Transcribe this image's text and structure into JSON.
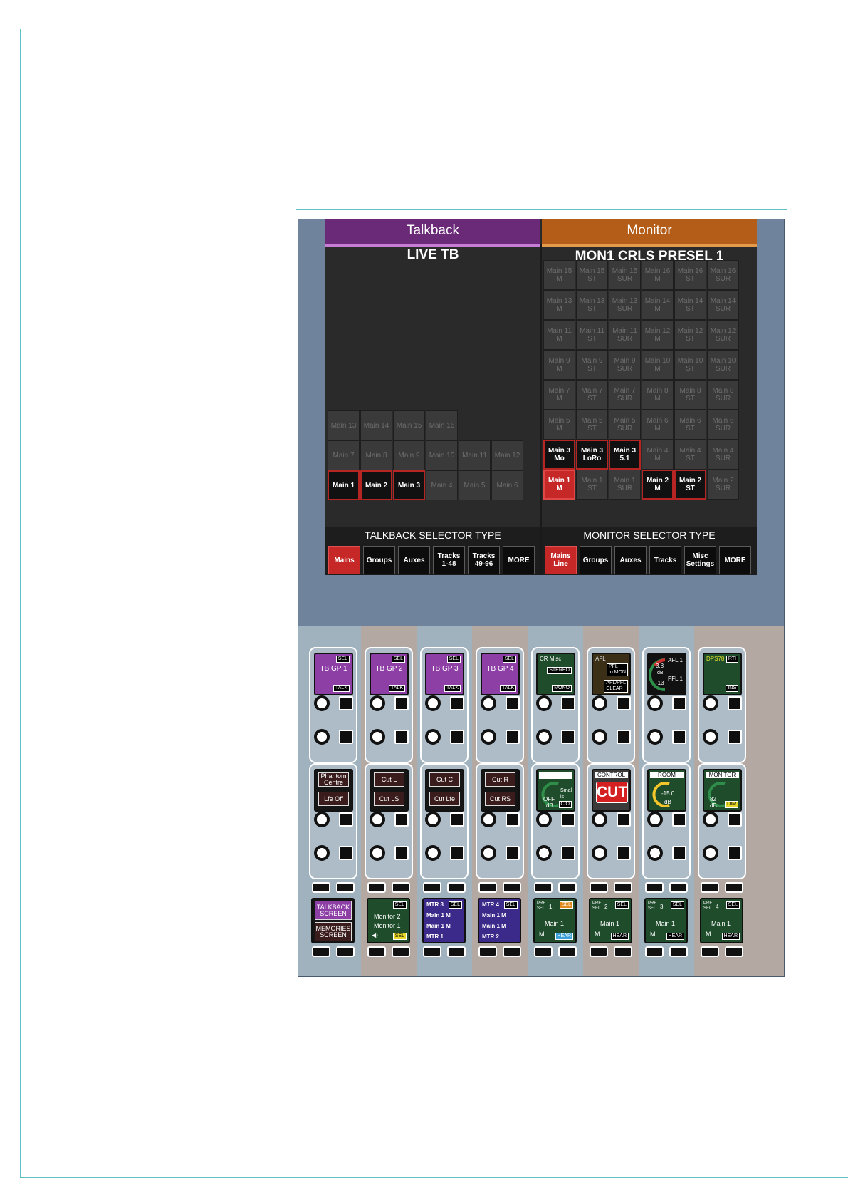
{
  "talkback": {
    "header": "Talkback",
    "subtitle": "LIVE TB",
    "grid": [
      {
        "label": "Main 13",
        "state": "dim"
      },
      {
        "label": "Main 14",
        "state": "dim"
      },
      {
        "label": "Main 15",
        "state": "dim"
      },
      {
        "label": "Main 16",
        "state": "dim"
      },
      {
        "label": "Main 7",
        "state": "dim"
      },
      {
        "label": "Main 8",
        "state": "dim"
      },
      {
        "label": "Main 9",
        "state": "dim"
      },
      {
        "label": "Main 10",
        "state": "dim"
      },
      {
        "label": "Main 11",
        "state": "dim"
      },
      {
        "label": "Main 12",
        "state": "dim"
      },
      {
        "label": "Main 1",
        "state": "active"
      },
      {
        "label": "Main 2",
        "state": "active"
      },
      {
        "label": "Main 3",
        "state": "active"
      },
      {
        "label": "Main 4",
        "state": "dim"
      },
      {
        "label": "Main 5",
        "state": "dim"
      },
      {
        "label": "Main 6",
        "state": "dim"
      }
    ],
    "selector_title": "TALKBACK SELECTOR TYPE",
    "selector_buttons": [
      {
        "label": "Mains",
        "state": "red"
      },
      {
        "label": "Groups",
        "state": "normal"
      },
      {
        "label": "Auxes",
        "state": "normal"
      },
      {
        "label": "Tracks\n1-48",
        "state": "normal"
      },
      {
        "label": "Tracks\n49-96",
        "state": "normal"
      },
      {
        "label": "MORE",
        "state": "normal"
      }
    ]
  },
  "monitor": {
    "header": "Monitor",
    "subtitle": "MON1 CRLS  PRESEL 1",
    "grid": [
      {
        "label": "Main 15\nM",
        "state": "dim"
      },
      {
        "label": "Main 15\nST",
        "state": "dim"
      },
      {
        "label": "Main 15\nSUR",
        "state": "dim"
      },
      {
        "label": "Main 16\nM",
        "state": "dim"
      },
      {
        "label": "Main 16\nST",
        "state": "dim"
      },
      {
        "label": "Main 16\nSUR",
        "state": "dim"
      },
      {
        "label": "Main 13\nM",
        "state": "dim"
      },
      {
        "label": "Main 13\nST",
        "state": "dim"
      },
      {
        "label": "Main 13\nSUR",
        "state": "dim"
      },
      {
        "label": "Main 14\nM",
        "state": "dim"
      },
      {
        "label": "Main 14\nST",
        "state": "dim"
      },
      {
        "label": "Main 14\nSUR",
        "state": "dim"
      },
      {
        "label": "Main 11\nM",
        "state": "dim"
      },
      {
        "label": "Main 11\nST",
        "state": "dim"
      },
      {
        "label": "Main 11\nSUR",
        "state": "dim"
      },
      {
        "label": "Main 12\nM",
        "state": "dim"
      },
      {
        "label": "Main 12\nST",
        "state": "dim"
      },
      {
        "label": "Main 12\nSUR",
        "state": "dim"
      },
      {
        "label": "Main 9\nM",
        "state": "dim"
      },
      {
        "label": "Main 9\nST",
        "state": "dim"
      },
      {
        "label": "Main 9\nSUR",
        "state": "dim"
      },
      {
        "label": "Main 10\nM",
        "state": "dim"
      },
      {
        "label": "Main 10\nST",
        "state": "dim"
      },
      {
        "label": "Main 10\nSUR",
        "state": "dim"
      },
      {
        "label": "Main 7\nM",
        "state": "dim"
      },
      {
        "label": "Main 7\nST",
        "state": "dim"
      },
      {
        "label": "Main 7\nSUR",
        "state": "dim"
      },
      {
        "label": "Main 8\nM",
        "state": "dim"
      },
      {
        "label": "Main 8\nST",
        "state": "dim"
      },
      {
        "label": "Main 8\nSUR",
        "state": "dim"
      },
      {
        "label": "Main 5\nM",
        "state": "dim"
      },
      {
        "label": "Main 5\nST",
        "state": "dim"
      },
      {
        "label": "Main 5\nSUR",
        "state": "dim"
      },
      {
        "label": "Main 6\nM",
        "state": "dim"
      },
      {
        "label": "Main 6\nST",
        "state": "dim"
      },
      {
        "label": "Main 6\nSUR",
        "state": "dim"
      },
      {
        "label": "Main 3\nMo",
        "state": "active"
      },
      {
        "label": "Main 3\nLoRo",
        "state": "active"
      },
      {
        "label": "Main 3\n5.1",
        "state": "active"
      },
      {
        "label": "Main 4\nM",
        "state": "dim"
      },
      {
        "label": "Main 4\nST",
        "state": "dim"
      },
      {
        "label": "Main 4\nSUR",
        "state": "dim"
      },
      {
        "label": "Main 1\nM",
        "state": "red"
      },
      {
        "label": "Main 1\nST",
        "state": "dim"
      },
      {
        "label": "Main 1\nSUR",
        "state": "dim"
      },
      {
        "label": "Main 2\nM",
        "state": "active"
      },
      {
        "label": "Main 2\nST",
        "state": "active"
      },
      {
        "label": "Main 2\nSUR",
        "state": "dim"
      }
    ],
    "selector_title": "MONITOR SELECTOR TYPE",
    "selector_buttons": [
      {
        "label": "Mains\nLine",
        "state": "red"
      },
      {
        "label": "Groups",
        "state": "normal"
      },
      {
        "label": "Auxes",
        "state": "normal"
      },
      {
        "label": "Tracks",
        "state": "normal"
      },
      {
        "label": "Misc\nSettings",
        "state": "normal"
      },
      {
        "label": "MORE",
        "state": "normal"
      }
    ]
  },
  "strip": {
    "column_colors": [
      "#9fb2bd",
      "#b3a8a2",
      "#9fb2bd",
      "#b3a8a2",
      "#9fb2bd",
      "#b3a8a2",
      "#9fb2bd",
      "#b3a8a2"
    ],
    "top_displays": [
      {
        "type": "tb",
        "title": "TB GP 1",
        "sel": "SEL",
        "talk": "TALK"
      },
      {
        "type": "tb",
        "title": "TB GP 2",
        "sel": "SEL",
        "talk": "TALK"
      },
      {
        "type": "tb",
        "title": "TB GP 3",
        "sel": "SEL",
        "talk": "TALK"
      },
      {
        "type": "tb",
        "title": "TB GP 4",
        "sel": "SEL",
        "talk": "TALK"
      },
      {
        "type": "crmisc",
        "title": "CR Misc",
        "btn1": "STEREO",
        "btn2": "MONO"
      },
      {
        "type": "afl",
        "title": "AFL",
        "btn1": "PFL\nto MON",
        "btn2": "AFL/PFL\nCLEAR"
      },
      {
        "type": "aflpfl",
        "afl": "AFL 1",
        "pfl": "PFL 1",
        "v1": "3.8",
        "v2": "-13",
        "unit": "dB"
      },
      {
        "type": "dps",
        "title": "DPS78",
        "btn1": "RTI",
        "btn2": "INS"
      }
    ],
    "mid_displays": [
      {
        "type": "two",
        "b1": "Phantom\nCentre",
        "b2": "Lfe Off"
      },
      {
        "type": "two",
        "b1": "Cut L",
        "b2": "Cut LS"
      },
      {
        "type": "two",
        "b1": "Cut C",
        "b2": "Cut Lfe"
      },
      {
        "type": "two",
        "b1": "Cut R",
        "b2": "Cut RS"
      },
      {
        "type": "gauge",
        "title": "",
        "val": "OFF",
        "unit": "dB",
        "extra": "Smal\nls",
        "tag": "C/O"
      },
      {
        "type": "control",
        "title": "CONTROL",
        "big": "CUT"
      },
      {
        "type": "room",
        "title": "ROOM",
        "val": "-15.0",
        "unit": "dB"
      },
      {
        "type": "monitor",
        "title": "MONITOR",
        "val": "82",
        "unit": "dB",
        "tag": "DIM"
      }
    ],
    "bottom_displays": [
      {
        "type": "screens",
        "b1": "TALKBACK\nSCREEN",
        "b2": "MEMORIES\nSCREEN"
      },
      {
        "type": "monitor",
        "sel": "SEL",
        "l1": "Monitor 2",
        "l2": "Monitor 1",
        "tag": "SEL"
      },
      {
        "type": "mtr",
        "r1": "MTR 3",
        "r2": "Main 1 M",
        "r3": "Main 1 M",
        "r4": "MTR 1",
        "sel": "SEL"
      },
      {
        "type": "mtr",
        "r1": "MTR 4",
        "r2": "Main 1 M",
        "r3": "Main 1 M",
        "r4": "MTR 2",
        "sel": "SEL"
      },
      {
        "type": "presel",
        "pre": "PRE\nSEL",
        "num": "1",
        "sel": "SEL",
        "main": "Main 1",
        "m": "M",
        "hear": "HEAR",
        "hl": true
      },
      {
        "type": "presel",
        "pre": "PRE\nSEL",
        "num": "2",
        "sel": "SEL",
        "main": "Main 1",
        "m": "M",
        "hear": "HEAR",
        "hl": false
      },
      {
        "type": "presel",
        "pre": "PRE\nSEL",
        "num": "3",
        "sel": "SEL",
        "main": "Main 1",
        "m": "M",
        "hear": "HEAR",
        "hl": false
      },
      {
        "type": "presel",
        "pre": "PRE\nSEL",
        "num": "4",
        "sel": "SEL",
        "main": "Main 1",
        "m": "M",
        "hear": "HEAR",
        "hl": false
      }
    ]
  }
}
